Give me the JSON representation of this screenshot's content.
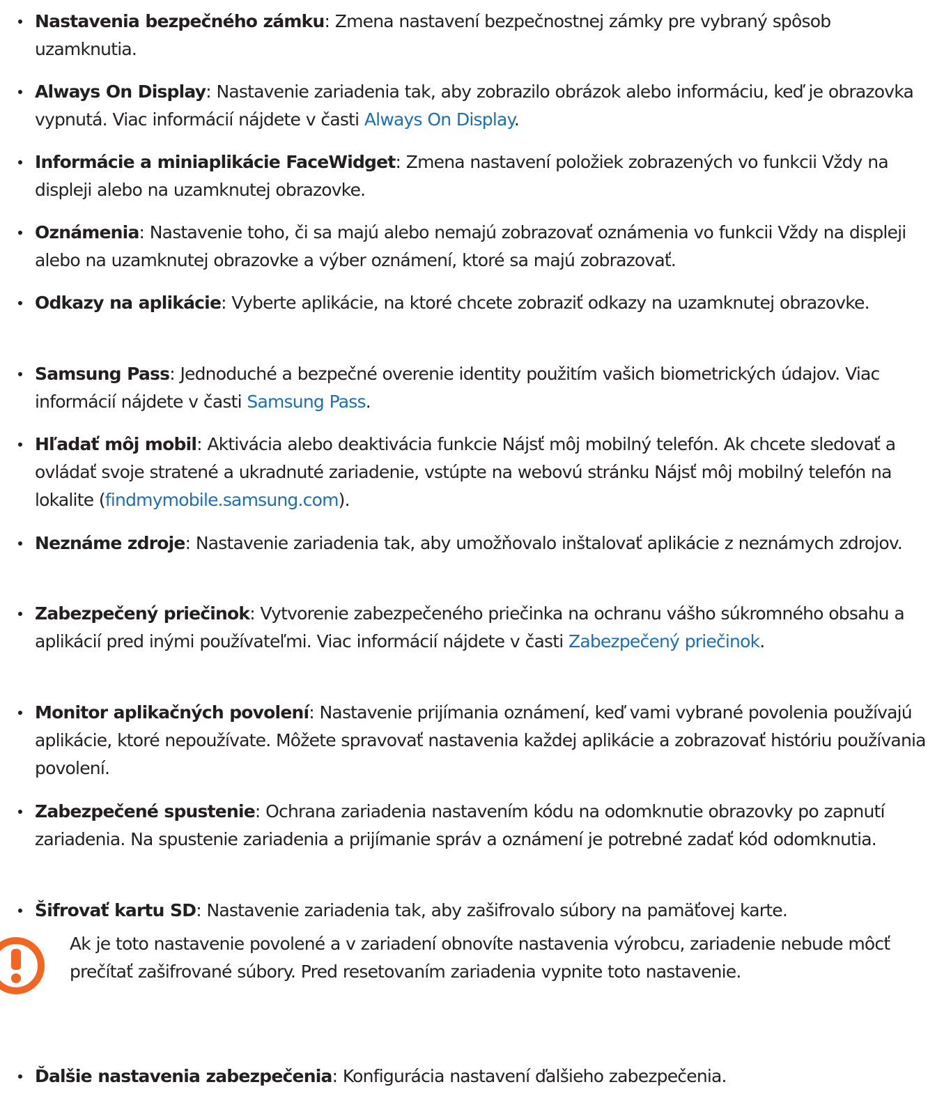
{
  "items": [
    {
      "term": "Nastavenia bezpečného zámku",
      "before": ": Zmena nastavení bezpečnostnej zámky pre vybraný spôsob uzamknutia.",
      "link": "",
      "after": ""
    },
    {
      "term": "Always On Display",
      "before": ": Nastavenie zariadenia tak, aby zobrazilo obrázok alebo informáciu, keď je obrazovka vypnutá. Viac informácií nájdete v časti ",
      "link": "Always On Display",
      "after": "."
    },
    {
      "term": "Informácie a miniaplikácie FaceWidget",
      "before": ": Zmena nastavení položiek zobrazených vo funkcii Vždy na displeji alebo na uzamknutej obrazovke.",
      "link": "",
      "after": ""
    },
    {
      "term": "Oznámenia",
      "before": ": Nastavenie toho, či sa majú alebo nemajú zobrazovať oznámenia vo funkcii Vždy na displeji alebo na uzamknutej obrazovke a výber oznámení, ktoré sa majú zobrazovať.",
      "link": "",
      "after": ""
    },
    {
      "term": "Odkazy na aplikácie",
      "before": ": Vyberte aplikácie, na ktoré chcete zobraziť odkazy na uzamknutej obrazovke.",
      "link": "",
      "after": ""
    },
    {
      "term": "Samsung Pass",
      "before": ": Jednoduché a bezpečné overenie identity použitím vašich biometrických údajov. Viac informácií nájdete v časti ",
      "link": "Samsung Pass",
      "after": "."
    },
    {
      "term": "Hľadať môj mobil",
      "before": ": Aktivácia alebo deaktivácia funkcie Nájsť môj mobilný telefón. Ak chcete sledovať a ovládať svoje stratené a ukradnuté zariadenie, vstúpte na webovú stránku Nájsť môj mobilný telefón na lokalite (",
      "link": "findmymobile.samsung.com",
      "after": ")."
    },
    {
      "term": "Neznáme zdroje",
      "before": ": Nastavenie zariadenia tak, aby umožňovalo inštalovať aplikácie z neznámych zdrojov.",
      "link": "",
      "after": ""
    },
    {
      "term": "Zabezpečený priečinok",
      "before": ": Vytvorenie zabezpečeného priečinka na ochranu vášho súkromného obsahu a aplikácií pred inými používateľmi. Viac informácií nájdete v časti ",
      "link": "Zabezpečený priečinok",
      "after": "."
    },
    {
      "term": "Monitor aplikačných povolení",
      "before": ": Nastavenie prijímania oznámení, keď vami vybrané povolenia používajú aplikácie, ktoré nepoužívate. Môžete spravovať nastavenia každej aplikácie a zobrazovať históriu používania povolení.",
      "link": "",
      "after": ""
    },
    {
      "term": "Zabezpečené spustenie",
      "before": ": Ochrana zariadenia nastavením kódu na odomknutie obrazovky po zapnutí zariadenia. Na spustenie zariadenia a prijímanie správ a oznámení je potrebné zadať kód odomknutia.",
      "link": "",
      "after": ""
    },
    {
      "term": "Šifrovať kartu SD",
      "before": ": Nastavenie zariadenia tak, aby zašifrovalo súbory na pamäťovej karte.",
      "link": "",
      "after": ""
    },
    {
      "term": "Ďalšie nastavenia zabezpečenia",
      "before": ": Konfigurácia nastavení ďalšieho zabezpečenia.",
      "link": "",
      "after": ""
    }
  ],
  "caution": {
    "icon": "caution-exclamation-icon",
    "text": "Ak je toto nastavenie povolené a v zariadení obnovíte nastavenia výrobcu, zariadenie nebude môcť prečítať zašifrované súbory. Pred resetovaním zariadenia vypnite toto nastavenie."
  },
  "colors": {
    "text": "#231f20",
    "link": "#1a6fb6",
    "caution": "#f26522"
  }
}
